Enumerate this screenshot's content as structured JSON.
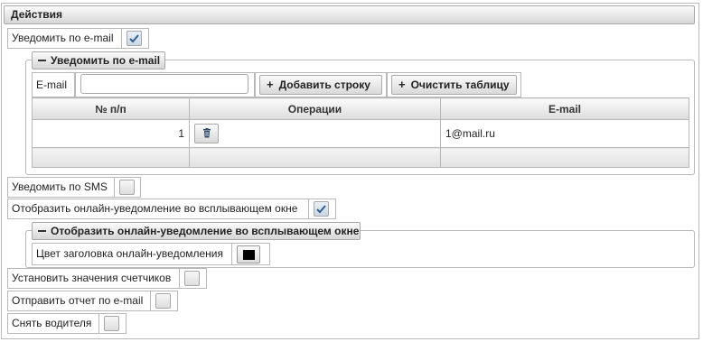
{
  "section": {
    "title": "Действия"
  },
  "notify_email": {
    "label": "Уведомить по e-mail",
    "checked": true
  },
  "email_group": {
    "legend": "Уведомить по e-mail",
    "email_label": "E-mail",
    "email_value": "",
    "add_row_label": "Добавить строку",
    "clear_table_label": "Очистить таблицу",
    "table": {
      "columns": [
        "№ п/п",
        "Операции",
        "E-mail"
      ],
      "rows": [
        {
          "index": "1",
          "email": "1@mail.ru"
        }
      ]
    }
  },
  "notify_sms": {
    "label": "Уведомить по SMS",
    "checked": false
  },
  "show_popup": {
    "label": "Отобразить онлайн-уведомление во всплывающем окне",
    "checked": true
  },
  "popup_group": {
    "legend": "Отобразить онлайн-уведомление во всплывающем окне",
    "header_color_label": "Цвет заголовка онлайн-уведомления",
    "header_color": "#000000"
  },
  "set_counters": {
    "label": "Установить значения счетчиков",
    "checked": false
  },
  "send_report": {
    "label": "Отправить отчет по e-mail",
    "checked": false
  },
  "remove_driver": {
    "label": "Снять водителя",
    "checked": false
  }
}
